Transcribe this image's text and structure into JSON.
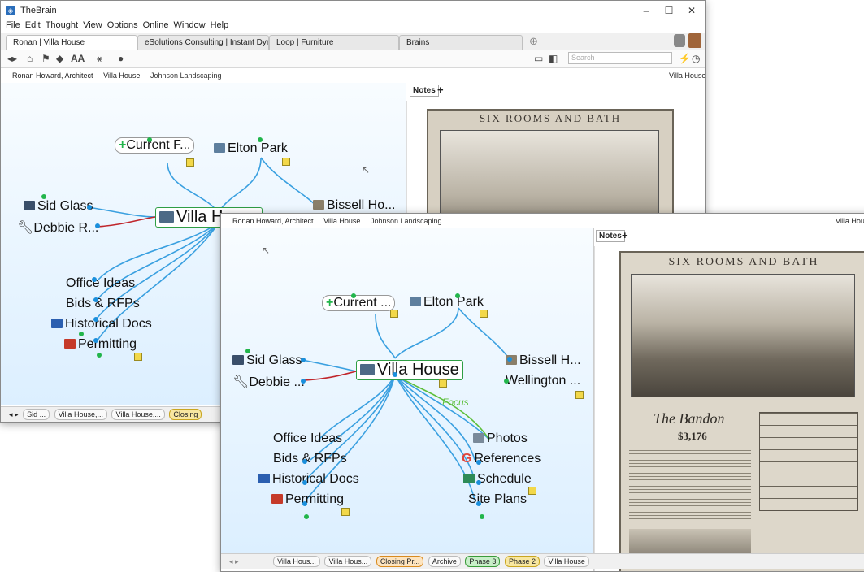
{
  "app": {
    "title": "TheBrain"
  },
  "window": {
    "minimize": "–",
    "maximize": "☐",
    "close": "✕"
  },
  "menu": [
    "File",
    "Edit",
    "Thought",
    "View",
    "Options",
    "Online",
    "Window",
    "Help"
  ],
  "tabs": [
    {
      "label": "Ronan | Villa House",
      "active": true
    },
    {
      "label": "eSolutions Consulting | Instant Dyna...",
      "active": false
    },
    {
      "label": "Loop | Furniture",
      "active": false
    },
    {
      "label": "Brains",
      "active": false
    }
  ],
  "toolbar": {
    "search_placeholder": "Search",
    "font_label": "AA"
  },
  "breadcrumb": {
    "items": [
      "Ronan Howard, Architect",
      "Villa House",
      "Johnson Landscaping"
    ],
    "right": "Villa House"
  },
  "notes": {
    "tab_label": "Notes",
    "add_label": "+",
    "poster_title": "SIX ROOMS AND BATH",
    "poster_name": "The Bandon",
    "poster_price": "$3,176"
  },
  "plex_back": {
    "active": "Villa House",
    "parents": [
      "Current F...",
      "Elton Park"
    ],
    "jumps": [
      "Sid Glass",
      "Debbie R..."
    ],
    "siblings": [
      "Bissell Ho..."
    ],
    "children": [
      "Office Ideas",
      "Bids & RFPs",
      "Historical Docs",
      "Permitting"
    ]
  },
  "plex_front": {
    "active": "Villa House",
    "parents": [
      "Current ...",
      "Elton Park"
    ],
    "jumps": [
      "Sid Glass",
      "Debbie ..."
    ],
    "siblings": [
      "Bissell H...",
      "Wellington ..."
    ],
    "children_left": [
      "Office Ideas",
      "Bids & RFPs",
      "Historical Docs",
      "Permitting"
    ],
    "children_right": [
      "Photos",
      "References",
      "Schedule",
      "Site Plans"
    ],
    "focus_label": "Focus"
  },
  "status_back": [
    "Sid ...",
    "Villa House,...",
    "Villa House,...",
    "Closing"
  ],
  "status_front": [
    "Villa Hous...",
    "Villa Hous...",
    "Closing Pr...",
    "Archive",
    "Phase 3",
    "Phase 2",
    "Villa House"
  ],
  "colors": {
    "link_blue": "#1a8fdc",
    "link_red": "#c0262c",
    "link_green": "#5cbf3a",
    "active_border": "#2f9e44",
    "plex_bg": "#e6f3ff"
  }
}
